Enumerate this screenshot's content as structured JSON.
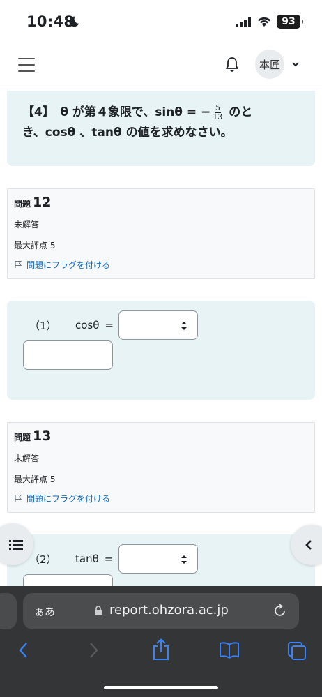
{
  "status": {
    "time": "10:48",
    "battery": "93"
  },
  "navbar": {
    "avatar_label": "本匠"
  },
  "question_text": {
    "prefix": "【4】　θ が第４象限で、sinθ = −",
    "frac_num": "5",
    "frac_den": "13",
    "suffix": " のと",
    "line2": "き、cosθ 、tanθ の値を求めなさい。"
  },
  "questions": [
    {
      "label": "問題",
      "number": "12",
      "status": "未解答",
      "max_score": "最大評点 5",
      "flag_label": "問題にフラグを付ける",
      "part_label": "（1）",
      "func_label": "cosθ",
      "equals": "="
    },
    {
      "label": "問題",
      "number": "13",
      "status": "未解答",
      "max_score": "最大評点 5",
      "flag_label": "問題にフラグを付ける",
      "part_label": "（2）",
      "func_label": "tanθ",
      "equals": "="
    }
  ],
  "browser": {
    "aa_label": "ぁあ",
    "url": "report.ohzora.ac.jp"
  },
  "colors": {
    "question_bg": "#e7f3f5",
    "link": "#0f6cbf",
    "safari_bar": "#343536",
    "safari_accent": "#3b82f6"
  }
}
